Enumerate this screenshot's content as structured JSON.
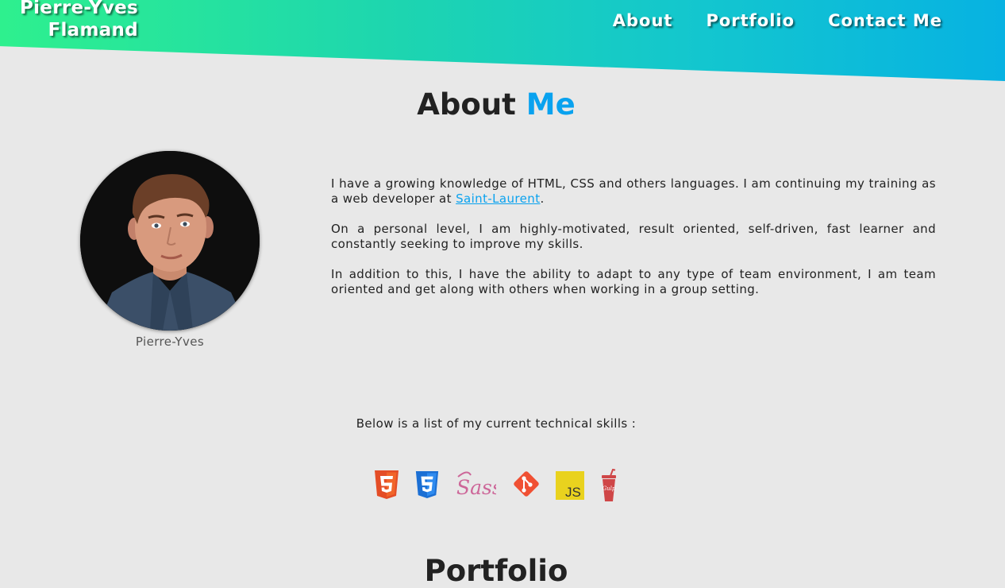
{
  "header": {
    "brand_line1": "Pierre-Yves",
    "brand_line2": "Flamand",
    "nav": [
      "About",
      "Portfolio",
      "Contact Me"
    ],
    "gradient_colors": [
      "#2ef08e",
      "#07b2e2"
    ]
  },
  "about": {
    "title_part1": "About",
    "title_part2": "Me",
    "accent_color": "#09a2ef",
    "photo_caption": "Pierre-Yves",
    "bio": {
      "p1_before_link": "I have a growing knowledge of HTML, CSS and others languages. I am continuing my training as a web developer at ",
      "p1_link": "Saint-Laurent",
      "p1_after_link": ".",
      "p2": "On a personal level, I am highly-motivated, result oriented, self-driven, fast learner and constantly seeking to improve my skills.",
      "p3": "In addition to this, I have the ability to adapt to any type of team environment, I am team oriented and get along with others when working in a group setting."
    }
  },
  "skills": {
    "intro": "Below is a list of my current technical skills :",
    "icons": [
      "html5-icon",
      "css3-icon",
      "sass-icon",
      "git-icon",
      "javascript-icon",
      "gulp-icon"
    ],
    "sass_text": "Sass",
    "js_text": "JS",
    "gulp_text": "Gulp"
  },
  "portfolio": {
    "title": "Portfolio"
  }
}
